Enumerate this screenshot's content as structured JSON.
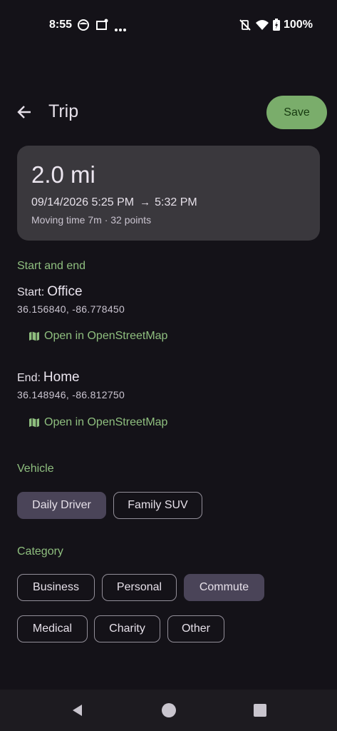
{
  "status_bar": {
    "time": "8:55",
    "battery": "100%",
    "icons": [
      "face-icon",
      "message-icon",
      "more-dots-icon",
      "vibrate-off-icon",
      "wifi-icon",
      "battery-icon"
    ]
  },
  "header": {
    "title": "Trip",
    "save_label": "Save",
    "back_icon": "arrow-back-icon"
  },
  "summary": {
    "distance": "2.0 mi",
    "start_time": "09/14/2026 5:25 PM",
    "arrow": "→",
    "end_time": "5:32 PM",
    "meta": "Moving time 7m · 32 points"
  },
  "start_end": {
    "section_label": "Start and end",
    "start": {
      "prefix": "Start:",
      "name": "Office",
      "coords": "36.156840, -86.778450",
      "link_label": "Open in OpenStreetMap"
    },
    "end": {
      "prefix": "End:",
      "name": "Home",
      "coords": "36.148946, -86.812750",
      "link_label": "Open in OpenStreetMap"
    }
  },
  "vehicle": {
    "section_label": "Vehicle",
    "options": [
      {
        "label": "Daily Driver",
        "selected": true
      },
      {
        "label": "Family SUV",
        "selected": false
      }
    ]
  },
  "category": {
    "section_label": "Category",
    "options": [
      {
        "label": "Business",
        "selected": false
      },
      {
        "label": "Personal",
        "selected": false
      },
      {
        "label": "Commute",
        "selected": true
      },
      {
        "label": "Medical",
        "selected": false
      },
      {
        "label": "Charity",
        "selected": false
      },
      {
        "label": "Other",
        "selected": false
      }
    ]
  },
  "colors": {
    "background": "#141218",
    "accent": "#8fbf7f",
    "save_button": "#7aad6b",
    "card": "#3a383d",
    "chip_selected": "#4a4458"
  }
}
